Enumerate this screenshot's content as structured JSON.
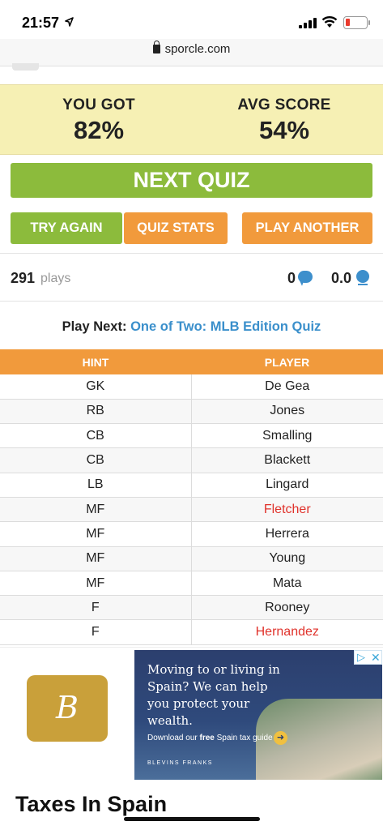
{
  "status_bar": {
    "time": "21:57",
    "battery_color": "#ea3b2e"
  },
  "browser": {
    "url": "sporcle.com"
  },
  "score": {
    "you_got_label": "YOU GOT",
    "you_got_value": "82%",
    "avg_label": "AVG SCORE",
    "avg_value": "54%"
  },
  "buttons": {
    "next_quiz": "NEXT QUIZ",
    "try_again": "TRY AGAIN",
    "quiz_stats": "QUIZ STATS",
    "play_another": "PLAY ANOTHER"
  },
  "stats": {
    "plays_count": "291",
    "plays_label": "plays",
    "comments": "0",
    "rating": "0.0"
  },
  "play_next": {
    "label": "Play Next:",
    "link": "One of Two: MLB Edition Quiz"
  },
  "table": {
    "headers": [
      "HINT",
      "PLAYER"
    ],
    "rows": [
      {
        "hint": "GK",
        "player": "De Gea",
        "missed": false
      },
      {
        "hint": "RB",
        "player": "Jones",
        "missed": false
      },
      {
        "hint": "CB",
        "player": "Smalling",
        "missed": false
      },
      {
        "hint": "CB",
        "player": "Blackett",
        "missed": false
      },
      {
        "hint": "LB",
        "player": "Lingard",
        "missed": false
      },
      {
        "hint": "MF",
        "player": "Fletcher",
        "missed": true
      },
      {
        "hint": "MF",
        "player": "Herrera",
        "missed": false
      },
      {
        "hint": "MF",
        "player": "Young",
        "missed": false
      },
      {
        "hint": "MF",
        "player": "Mata",
        "missed": false
      },
      {
        "hint": "F",
        "player": "Rooney",
        "missed": false
      },
      {
        "hint": "F",
        "player": "Hernandez",
        "missed": true
      }
    ]
  },
  "ad": {
    "headline": "Moving to or living in Spain? We can help you protect your wealth.",
    "cta_prefix": "Download our ",
    "cta_bold": "free",
    "cta_suffix": " Spain tax guide",
    "brand": "BLEVINS FRANKS",
    "logo_glyph": "B",
    "title": "Taxes In Spain"
  },
  "colors": {
    "green": "#8cbb3c",
    "orange": "#f19a3c",
    "score_bg": "#f6f0b4",
    "link_blue": "#3a8fcb",
    "missed_red": "#e0322b"
  }
}
